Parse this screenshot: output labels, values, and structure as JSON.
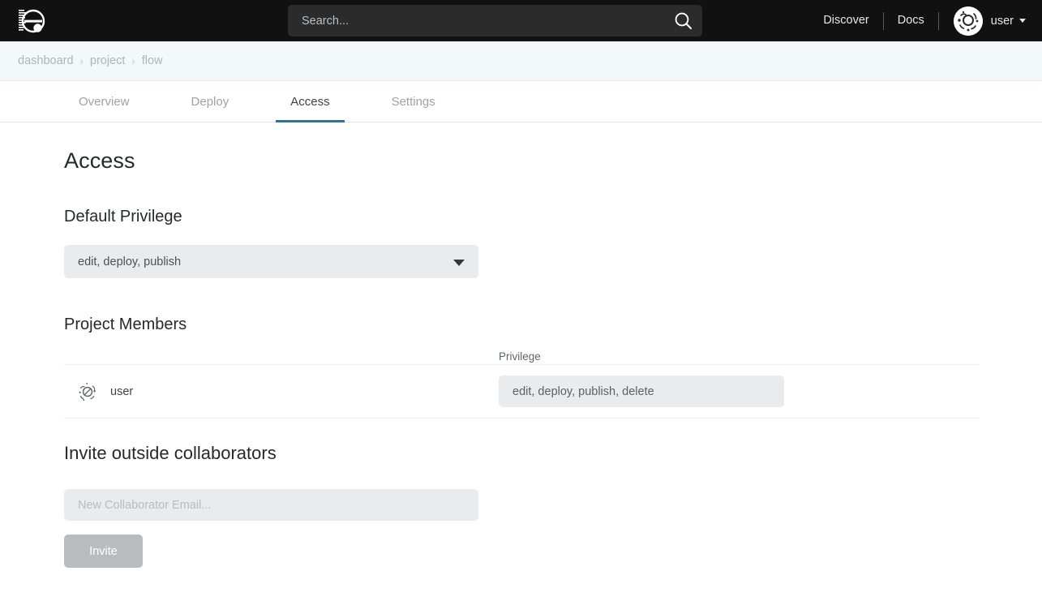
{
  "header": {
    "logo_icon": "circular-app-logo-icon",
    "search": {
      "placeholder": "Search...",
      "value": "",
      "icon": "search-icon"
    },
    "links": [
      {
        "label": "Discover"
      },
      {
        "label": "Docs"
      }
    ],
    "avatar_icon": "user-avatar-identicon-icon",
    "user_label": "user",
    "caret_icon": "chevron-down-icon"
  },
  "breadcrumb": {
    "separator": "›",
    "items": [
      {
        "label": "dashboard"
      },
      {
        "label": "project"
      },
      {
        "label": "flow"
      }
    ]
  },
  "tabs": [
    {
      "label": "Overview",
      "active": false
    },
    {
      "label": "Deploy",
      "active": false
    },
    {
      "label": "Access",
      "active": true
    },
    {
      "label": "Settings",
      "active": false
    }
  ],
  "main": {
    "page_title": "Access",
    "default_privilege": {
      "heading": "Default Privilege",
      "selected": "edit, deploy, publish",
      "caret_icon": "caret-down-icon"
    },
    "project_members": {
      "heading": "Project Members",
      "columns": [
        "",
        "Privilege"
      ],
      "rows": [
        {
          "avatar_icon": "member-avatar-identicon-icon",
          "name": "user",
          "privilege": "edit, deploy, publish, delete"
        }
      ]
    },
    "invite": {
      "heading": "Invite outside collaborators",
      "email_placeholder": "New Collaborator Email...",
      "email_value": "",
      "button_label": "Invite"
    }
  },
  "colors": {
    "topnav_bg": "#111111",
    "search_bg": "#2b2b2b",
    "breadcrumb_bg": "#f3f8f9",
    "active_tab_underline": "#2e7295",
    "field_bg": "#e9ecef",
    "invite_button_bg": "#b9bcbe"
  }
}
